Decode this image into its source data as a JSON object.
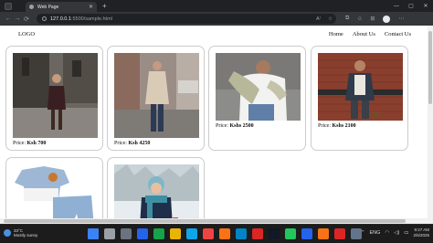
{
  "browser": {
    "tab_title": "Web Page",
    "tab_close": "✕",
    "new_tab": "+",
    "url_host": "127.0.0.1",
    "url_path": ":5500/sample.html",
    "controls": {
      "minimize": "—",
      "maximize": "▢",
      "close": "✕"
    },
    "nav": {
      "back": "←",
      "forward": "→",
      "reload": "⟳"
    },
    "omni_icons": {
      "read_aloud": "A⁾",
      "favorite": "☆"
    },
    "toolbar_icons": {
      "split": "⧉",
      "favorites": "✩",
      "collections": "⊞"
    }
  },
  "site": {
    "logo": "LOGO",
    "nav_links": [
      "Home",
      "About Us",
      "Contact Us"
    ],
    "products": [
      {
        "price_label": "Price:",
        "price": "Ksh 700",
        "image": "woman-street-photo"
      },
      {
        "price_label": "Price:",
        "price": "Ksh 4250",
        "image": "woman-street-beige-coat-photo"
      },
      {
        "price_label": "Price:",
        "price": "Kshs 2500",
        "image": "man-knit-sweater-photo"
      },
      {
        "price_label": "Price:",
        "price": "Kshs 2100",
        "image": "man-brick-wall-photo"
      },
      {
        "price_label": "",
        "price": "",
        "image": "kids-blue-outfit-photo"
      },
      {
        "price_label": "",
        "price": "",
        "image": "child-snow-scarf-photo"
      }
    ]
  },
  "taskbar": {
    "weather_temp": "33°C",
    "weather_desc": "Mostly sunny",
    "lang": "ENG",
    "time": "9:27 AM",
    "date": "2/6/2025",
    "apps": [
      "start-icon",
      "search-icon",
      "task-view-icon",
      "widgets-icon",
      "chat-icon",
      "files-icon",
      "photos-icon",
      "youtube-icon",
      "brave-icon",
      "edge-icon",
      "netflix-icon",
      "tiktok-icon",
      "chrome-icon",
      "vscode-icon",
      "firefox-icon",
      "opera-icon",
      "app-icon"
    ],
    "tray_icons": {
      "chevron": "⌃",
      "wifi": "◠",
      "volume": "◁)",
      "battery": "▭"
    }
  }
}
